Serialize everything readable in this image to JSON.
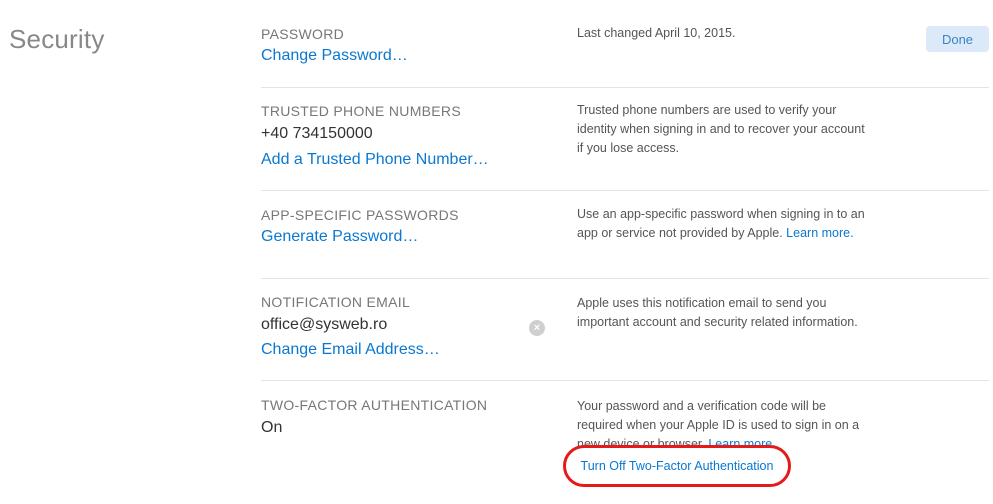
{
  "page": {
    "title": "Security",
    "done_label": "Done"
  },
  "password": {
    "label": "PASSWORD",
    "link": "Change Password…",
    "description": "Last changed April 10, 2015."
  },
  "trusted_phones": {
    "label": "TRUSTED PHONE NUMBERS",
    "number": "+40 734150000",
    "link": "Add a Trusted Phone Number…",
    "description": "Trusted phone numbers are used to verify your identity when signing in and to recover your account if you lose access."
  },
  "app_passwords": {
    "label": "APP-SPECIFIC PASSWORDS",
    "link": "Generate Password…",
    "description": "Use an app-specific password when signing in to an app or service not provided by Apple.",
    "learn_more": "Learn more."
  },
  "notification_email": {
    "label": "NOTIFICATION EMAIL",
    "email": "office@sysweb.ro",
    "link": "Change Email Address…",
    "clear_icon": "clear-icon",
    "description": "Apple uses this notification email to send you important account and security related information."
  },
  "two_factor": {
    "label": "TWO-FACTOR AUTHENTICATION",
    "status": "On",
    "description": "Your password and a verification code will be required when your Apple ID is used to sign in on a new device or browser.",
    "learn_more": "Learn more.",
    "turn_off_link": "Turn Off Two-Factor Authentication",
    "highlight_color": "#e41b1b"
  },
  "colors": {
    "link": "#0a78d0",
    "done_bg": "#dbe9f8"
  }
}
